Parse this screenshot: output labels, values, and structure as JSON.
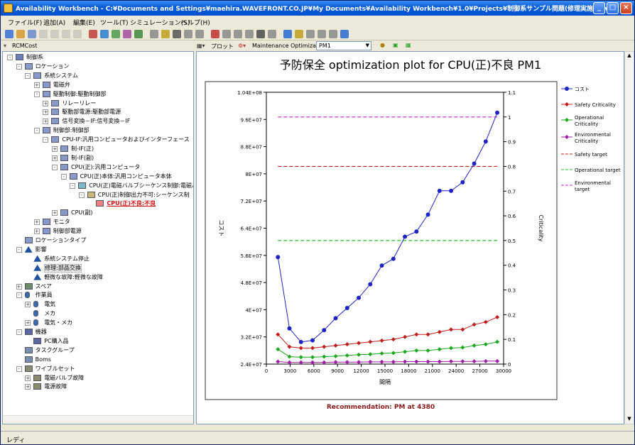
{
  "window": {
    "title": "Availability Workbench - C:¥Documents and Settings¥maehira.WAVEFRONT.CO.JP¥My Documents¥Availability Workbench¥1.0¥Projects¥制御系サンプル問題(修理実施).awbx"
  },
  "menu": [
    "ファイル(F)",
    "追加(A)",
    "編集(E)",
    "ツール(T)",
    "シミュレーション(S)",
    "ヘルプ(H)"
  ],
  "left_panel": {
    "dropdown_label": "RCMCost"
  },
  "right_panel": {
    "plot_menu": "プロット",
    "view_label": "Maintenance Optimization",
    "selector_value": "PM1"
  },
  "tree": [
    {
      "label": "制御系",
      "level": 0,
      "exp": "-",
      "icon": "system"
    },
    {
      "label": "ロケーション",
      "level": 1,
      "exp": "-",
      "icon": "box"
    },
    {
      "label": "系統システム",
      "level": 2,
      "exp": "-",
      "icon": "box"
    },
    {
      "label": "電磁弁",
      "level": 3,
      "exp": "+",
      "icon": "box"
    },
    {
      "label": "駆動制御:駆動制御部",
      "level": 3,
      "exp": "-",
      "icon": "box"
    },
    {
      "label": "リレーリレー",
      "level": 4,
      "exp": "+",
      "icon": "box"
    },
    {
      "label": "駆動部電源:駆動部電源",
      "level": 4,
      "exp": "+",
      "icon": "box"
    },
    {
      "label": "信号変換－IF:信号変換－IF",
      "level": 4,
      "exp": "+",
      "icon": "box"
    },
    {
      "label": "制御部:制御部",
      "level": 3,
      "exp": "-",
      "icon": "box"
    },
    {
      "label": "CPU-IF:汎用コンピュータおよびインターフェース",
      "level": 4,
      "exp": "-",
      "icon": "box"
    },
    {
      "label": "制-IF(正)",
      "level": 5,
      "exp": "+",
      "icon": "box"
    },
    {
      "label": "制-IF(副)",
      "level": 5,
      "exp": "+",
      "icon": "box"
    },
    {
      "label": "CPU(正):汎用コンピュータ",
      "level": 5,
      "exp": "-",
      "icon": "box"
    },
    {
      "label": "CPU(正)本体:汎用コンピュータ本体",
      "level": 6,
      "exp": "-",
      "icon": "box"
    },
    {
      "label": "CPU(正)電磁バルブシーケンス制御:電磁バ",
      "level": 7,
      "exp": "-",
      "icon": "func"
    },
    {
      "label": "CPU(正)制御出力不可:シーケンス制",
      "level": 8,
      "exp": "-",
      "icon": "fail"
    },
    {
      "label": "CPU(正)不良:不良",
      "level": 9,
      "exp": "",
      "icon": "mode",
      "selected": true
    },
    {
      "label": "CPU(副)",
      "level": 5,
      "exp": "+",
      "icon": "box"
    },
    {
      "label": "モニタ",
      "level": 3,
      "exp": "+",
      "icon": "box"
    },
    {
      "label": "制御部電源",
      "level": 3,
      "exp": "+",
      "icon": "box"
    },
    {
      "label": "ロケーションタイプ",
      "level": 1,
      "exp": "",
      "icon": "box"
    },
    {
      "label": "影響",
      "level": 1,
      "exp": "-",
      "icon": "warn"
    },
    {
      "label": "系統システム停止",
      "level": 2,
      "exp": "",
      "icon": "warn"
    },
    {
      "label": "修理:部品交換",
      "level": 2,
      "exp": "",
      "icon": "warn",
      "hl": true
    },
    {
      "label": "軽微な故障:軽微な故障",
      "level": 2,
      "exp": "",
      "icon": "warn"
    },
    {
      "label": "スペア",
      "level": 1,
      "exp": "+",
      "icon": "gear"
    },
    {
      "label": "作業員",
      "level": 1,
      "exp": "-",
      "icon": "person"
    },
    {
      "label": "電気",
      "level": 2,
      "exp": "+",
      "icon": "person"
    },
    {
      "label": "メカ",
      "level": 2,
      "exp": "",
      "icon": "person"
    },
    {
      "label": "電気・メカ",
      "level": 2,
      "exp": "+",
      "icon": "person"
    },
    {
      "label": "機器",
      "level": 1,
      "exp": "-",
      "icon": "tool"
    },
    {
      "label": "PC購入品",
      "level": 2,
      "exp": "",
      "icon": "tool"
    },
    {
      "label": "タスクグループ",
      "level": 1,
      "exp": "",
      "icon": "task"
    },
    {
      "label": "Boms",
      "level": 1,
      "exp": "",
      "icon": "task"
    },
    {
      "label": "ワイブルセット",
      "level": 1,
      "exp": "-",
      "icon": "db"
    },
    {
      "label": "電磁バルブ故障",
      "level": 2,
      "exp": "+",
      "icon": "db"
    },
    {
      "label": "電源故障",
      "level": 2,
      "exp": "+",
      "icon": "db"
    }
  ],
  "chart_data": {
    "type": "line",
    "title": "予防保全 optimization plot for CPU(正)不良 PM1",
    "xlabel": "間隔",
    "ylabel": "コスト",
    "y2label": "Criticality",
    "xlim": [
      0,
      30000
    ],
    "xticks": [
      "0",
      "3000",
      "6000",
      "9000",
      "12000",
      "15000",
      "18000",
      "21000",
      "24000",
      "27000",
      "30000"
    ],
    "ylim": [
      24000000,
      104000000
    ],
    "yticks": [
      "2.4E+07",
      "3.2E+07",
      "4E+07",
      "4.8E+07",
      "5.6E+07",
      "6.4E+07",
      "7.2E+07",
      "8E+07",
      "8.8E+07",
      "9.6E+07",
      "1.04E+08"
    ],
    "y2lim": [
      0,
      1.1
    ],
    "y2ticks": [
      "0",
      "0.1",
      "0.2",
      "0.3",
      "0.4",
      "0.5",
      "0.6",
      "0.7",
      "0.8",
      "0.9",
      "1",
      "1.1"
    ],
    "x": [
      1460,
      2920,
      4380,
      5840,
      7300,
      8760,
      10220,
      11680,
      13140,
      14600,
      16060,
      17520,
      18980,
      20440,
      21900,
      23360,
      24820,
      26280,
      27740,
      29200
    ],
    "series": [
      {
        "name": "コスト",
        "axis": "left",
        "color": "#1f24c0",
        "marker": "circle",
        "values": [
          55500000,
          34500000,
          30500000,
          31000000,
          34000000,
          37500000,
          40500000,
          43500000,
          47500000,
          53000000,
          55000000,
          61500000,
          63000000,
          68000000,
          75000000,
          75000000,
          77500000,
          83000000,
          89500000,
          98000000
        ]
      },
      {
        "name": "Safety Criticality",
        "axis": "right",
        "color": "#c01c1c",
        "marker": "diamond",
        "values": [
          0.12,
          0.07,
          0.065,
          0.065,
          0.07,
          0.075,
          0.08,
          0.085,
          0.09,
          0.095,
          0.1,
          0.11,
          0.12,
          0.12,
          0.13,
          0.14,
          0.14,
          0.16,
          0.17,
          0.19
        ]
      },
      {
        "name": "Operational Criticality",
        "axis": "right",
        "color": "#1ca81c",
        "marker": "diamond",
        "values": [
          0.06,
          0.03,
          0.028,
          0.028,
          0.03,
          0.032,
          0.035,
          0.038,
          0.04,
          0.043,
          0.045,
          0.05,
          0.055,
          0.055,
          0.06,
          0.065,
          0.067,
          0.075,
          0.08,
          0.09
        ]
      },
      {
        "name": "Environmental Criticality",
        "axis": "right",
        "color": "#a01ca8",
        "marker": "diamond",
        "values": [
          0.01,
          0.007,
          0.007,
          0.007,
          0.007,
          0.008,
          0.008,
          0.008,
          0.009,
          0.009,
          0.009,
          0.01,
          0.01,
          0.01,
          0.01,
          0.011,
          0.011,
          0.011,
          0.012,
          0.012
        ]
      }
    ],
    "targets": [
      {
        "name": "Safety target",
        "value": 0.8,
        "color": "#d02020"
      },
      {
        "name": "Operational target",
        "value": 0.5,
        "color": "#20c020"
      },
      {
        "name": "Environmental target",
        "value": 1.0,
        "color": "#d020d0"
      }
    ],
    "legend": [
      {
        "label": "コスト",
        "kind": "circle",
        "color": "#1f24c0"
      },
      {
        "label": "Safety Criticality",
        "kind": "diamond",
        "color": "#c01c1c"
      },
      {
        "label": "Operational Criticality",
        "kind": "diamond",
        "color": "#1ca81c"
      },
      {
        "label": "Environmental Criticality",
        "kind": "diamond",
        "color": "#a01ca8"
      },
      {
        "label": "Safety target",
        "kind": "dash",
        "color": "#d02020"
      },
      {
        "label": "Operational target",
        "kind": "dash",
        "color": "#20c020"
      },
      {
        "label": "Environmental target",
        "kind": "dash",
        "color": "#d020d0"
      }
    ],
    "legend_position": "right",
    "recommendation": "Recommendation: PM at 4380"
  },
  "status": "レディ"
}
